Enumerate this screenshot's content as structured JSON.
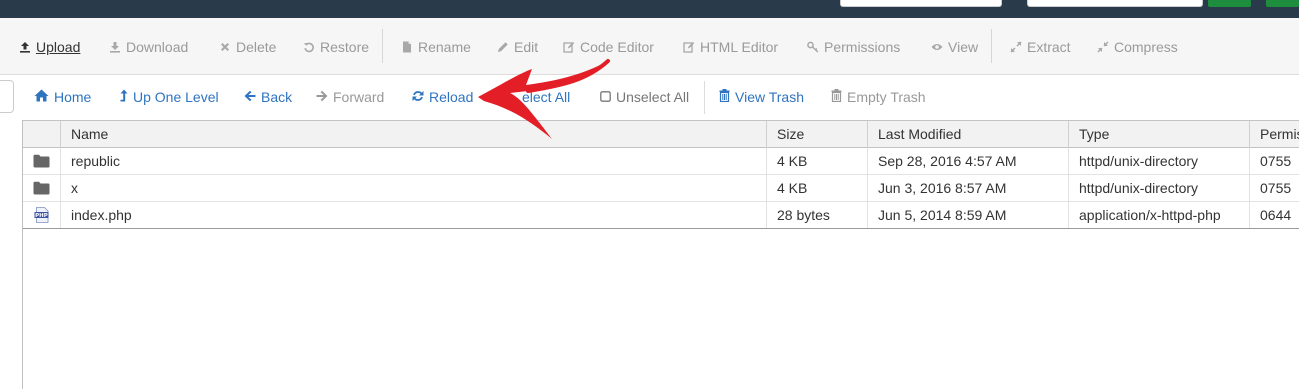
{
  "toolbar": {
    "upload": "Upload",
    "download": "Download",
    "delete": "Delete",
    "restore": "Restore",
    "rename": "Rename",
    "edit": "Edit",
    "code_editor": "Code Editor",
    "html_editor": "HTML Editor",
    "permissions": "Permissions",
    "view": "View",
    "extract": "Extract",
    "compress": "Compress"
  },
  "nav": {
    "home": "Home",
    "up_one_level": "Up One Level",
    "back": "Back",
    "forward": "Forward",
    "reload": "Reload",
    "select_all_partial": "elect All",
    "unselect_all": "Unselect All",
    "view_trash": "View Trash",
    "empty_trash": "Empty Trash"
  },
  "table": {
    "columns": [
      "Name",
      "Size",
      "Last Modified",
      "Type",
      "Permis"
    ],
    "rows": [
      {
        "icon": "folder-icon",
        "name": "republic",
        "size": "4 KB",
        "modified": "Sep 28, 2016 4:57 AM",
        "type": "httpd/unix-directory",
        "perms": "0755"
      },
      {
        "icon": "folder-icon",
        "name": "x",
        "size": "4 KB",
        "modified": "Jun 3, 2016 8:57 AM",
        "type": "httpd/unix-directory",
        "perms": "0755"
      },
      {
        "icon": "php-file-icon",
        "name": "index.php",
        "size": "28 bytes",
        "modified": "Jun 5, 2014 8:59 AM",
        "type": "application/x-httpd-php",
        "perms": "0644"
      }
    ]
  },
  "colors": {
    "header": "#293a4a",
    "link": "#2f74c0",
    "disabled": "#9a9a9a",
    "annotation": "#e41e26"
  }
}
